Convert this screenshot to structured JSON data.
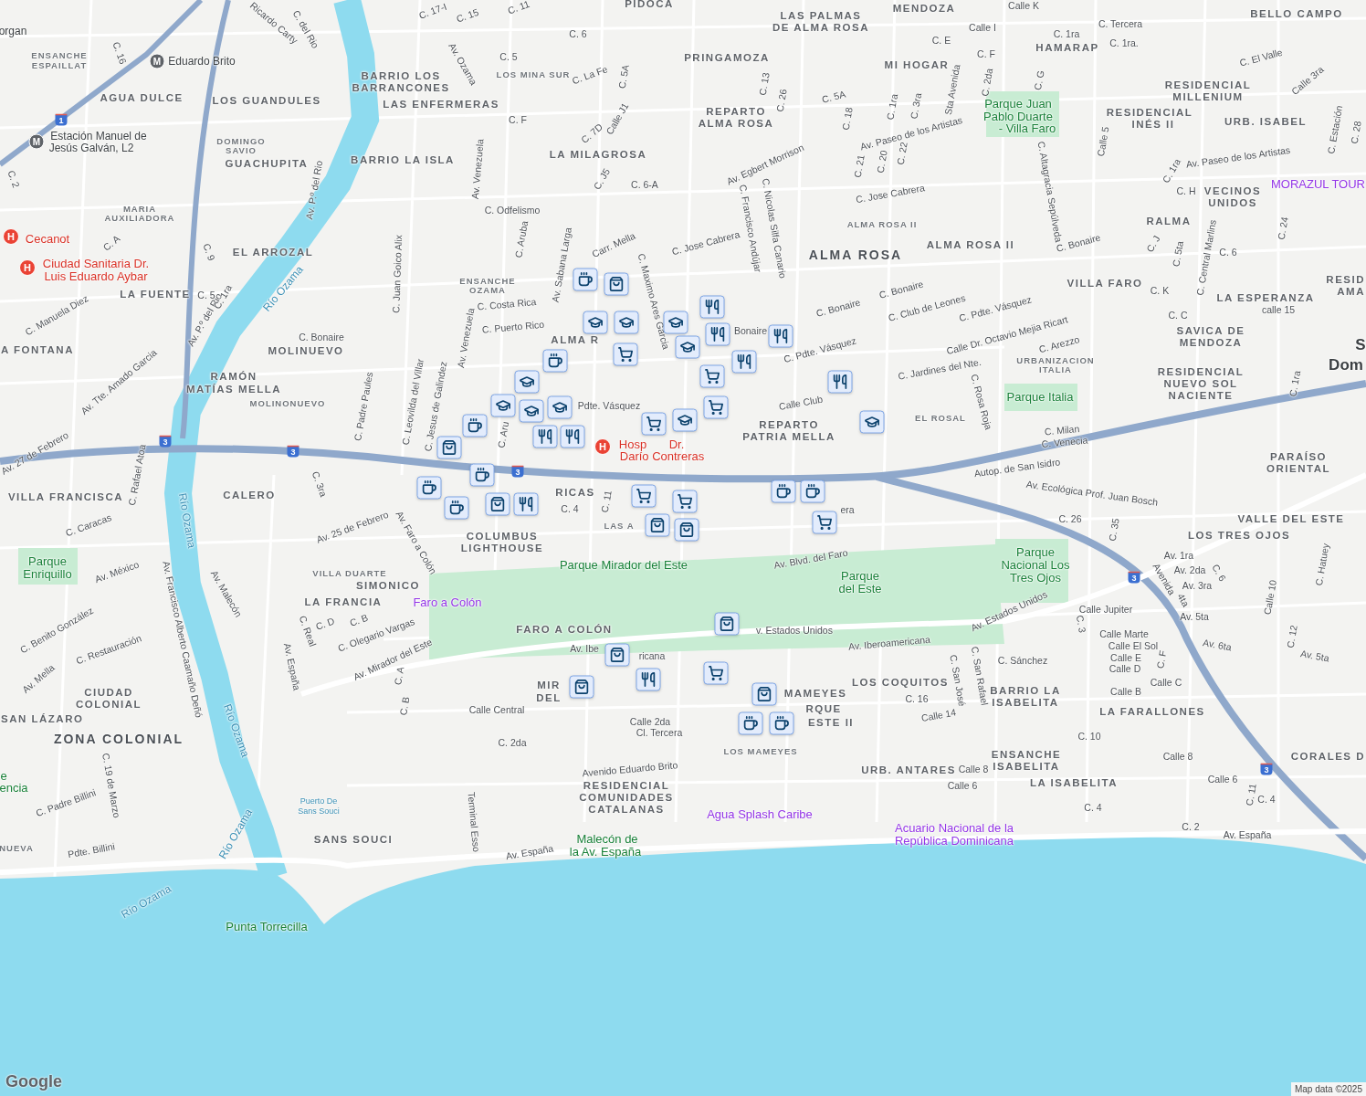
{
  "map": {
    "labels": [
      {
        "text": "ENSANCHE",
        "kind": "district-small"
      },
      {
        "text": "ESPAILLAT",
        "kind": "district-small"
      },
      {
        "text": "AGUA DULCE",
        "kind": "district"
      },
      {
        "text": "LOS GUANDULES",
        "kind": "district"
      },
      {
        "text": "BARRIO LOS",
        "kind": "district"
      },
      {
        "text": "BARRANCONES",
        "kind": "district"
      },
      {
        "text": "LAS ENFERMERAS",
        "kind": "district"
      },
      {
        "text": "PIDOCA",
        "kind": "district"
      },
      {
        "text": "LAS PALMAS",
        "kind": "district"
      },
      {
        "text": "DE ALMA ROSA",
        "kind": "district"
      },
      {
        "text": "MENDOZA",
        "kind": "district"
      },
      {
        "text": "BELLO CAMPO",
        "kind": "district"
      },
      {
        "text": "HAMARAP",
        "kind": "district"
      },
      {
        "text": "MI HOGAR",
        "kind": "district"
      },
      {
        "text": "PRINGAMOZA",
        "kind": "district"
      },
      {
        "text": "REPARTO",
        "kind": "district"
      },
      {
        "text": "ALMA ROSA",
        "kind": "district"
      },
      {
        "text": "RESIDENCIAL",
        "kind": "district"
      },
      {
        "text": "MILLENIUM",
        "kind": "district"
      },
      {
        "text": "RESIDENCIAL",
        "kind": "district"
      },
      {
        "text": "INÉS II",
        "kind": "district"
      },
      {
        "text": "URB. ISABEL",
        "kind": "district"
      },
      {
        "text": "DOMINGO",
        "kind": "district-small"
      },
      {
        "text": "SAVIO",
        "kind": "district-small"
      },
      {
        "text": "GUACHUPITA",
        "kind": "district"
      },
      {
        "text": "BARRIO LA ISLA",
        "kind": "district"
      },
      {
        "text": "LA MILAGROSA",
        "kind": "district"
      },
      {
        "text": "VECINOS",
        "kind": "district"
      },
      {
        "text": "UNIDOS",
        "kind": "district"
      },
      {
        "text": "MARIA",
        "kind": "district-small"
      },
      {
        "text": "AUXILIADORA",
        "kind": "district-small"
      },
      {
        "text": "RALMA",
        "kind": "district"
      },
      {
        "text": "EL ARROZAL",
        "kind": "district"
      },
      {
        "text": "ALMA ROSA",
        "kind": "district-large"
      },
      {
        "text": "ALMA ROSA II",
        "kind": "district"
      },
      {
        "text": "ENSANCHE",
        "kind": "district-small"
      },
      {
        "text": "OZAMA",
        "kind": "district-small"
      },
      {
        "text": "LA FUENTE",
        "kind": "district"
      },
      {
        "text": "VILLA FARO",
        "kind": "district"
      },
      {
        "text": "LA ESPERANZA",
        "kind": "district"
      },
      {
        "text": "A FONTANA",
        "kind": "district"
      },
      {
        "text": "MOLINUEVO",
        "kind": "district"
      },
      {
        "text": "SAVICA DE",
        "kind": "district"
      },
      {
        "text": "MENDOZA",
        "kind": "district"
      },
      {
        "text": "URBANIZACION",
        "kind": "district-small"
      },
      {
        "text": "ITALIA",
        "kind": "district-small"
      },
      {
        "text": "RAMÓN",
        "kind": "district"
      },
      {
        "text": "MATÍAS MELLA",
        "kind": "district"
      },
      {
        "text": "MOLINONUEVO",
        "kind": "district-small"
      },
      {
        "text": "RESIDENCIAL",
        "kind": "district"
      },
      {
        "text": "NUEVO SOL",
        "kind": "district"
      },
      {
        "text": "NACIENTE",
        "kind": "district"
      },
      {
        "text": "EL ROSAL",
        "kind": "district-small"
      },
      {
        "text": "REPARTO",
        "kind": "district"
      },
      {
        "text": "PATRIA MELLA",
        "kind": "district"
      },
      {
        "text": "PARAÍSO",
        "kind": "district"
      },
      {
        "text": "ORIENTAL",
        "kind": "district"
      },
      {
        "text": "VILLA FRANCISCA",
        "kind": "district"
      },
      {
        "text": "CALERO",
        "kind": "district"
      },
      {
        "text": "COLUMBUS",
        "kind": "district"
      },
      {
        "text": "LIGHTHOUSE",
        "kind": "district"
      },
      {
        "text": "VALLE DEL ESTE",
        "kind": "district"
      },
      {
        "text": "LOS TRES OJOS",
        "kind": "district"
      },
      {
        "text": "VILLA DUARTE",
        "kind": "district-small"
      },
      {
        "text": "SIMONICO",
        "kind": "district"
      },
      {
        "text": "LA FRANCIA",
        "kind": "district"
      },
      {
        "text": "FARO A COLÓN",
        "kind": "district"
      },
      {
        "text": "LOS COQUITOS",
        "kind": "district"
      },
      {
        "text": "BARRIO LA",
        "kind": "district"
      },
      {
        "text": "ISABELITA",
        "kind": "district"
      },
      {
        "text": "LA FARALLONES",
        "kind": "district"
      },
      {
        "text": "CIUDAD",
        "kind": "district"
      },
      {
        "text": "COLONIAL",
        "kind": "district"
      },
      {
        "text": "SAN LÁZARO",
        "kind": "district"
      },
      {
        "text": "ZONA COLONIAL",
        "kind": "district-large"
      },
      {
        "text": "ENSANCHE",
        "kind": "district"
      },
      {
        "text": "ISABELITA",
        "kind": "district"
      },
      {
        "text": "LA ISABELITA",
        "kind": "district"
      },
      {
        "text": "URB. ANTARES",
        "kind": "district"
      },
      {
        "text": "CORALES D",
        "kind": "district"
      },
      {
        "text": "RESIDENCIAL",
        "kind": "district"
      },
      {
        "text": "COMUNIDADES",
        "kind": "district"
      },
      {
        "text": "CATALANAS",
        "kind": "district"
      },
      {
        "text": "SANS SOUCI",
        "kind": "district"
      },
      {
        "text": "NUEVA",
        "kind": "district-small"
      },
      {
        "text": "LOS MAMEYES",
        "kind": "district-small"
      },
      {
        "text": "MAMEYES",
        "kind": "district"
      },
      {
        "text": "RQUE",
        "kind": "district"
      },
      {
        "text": "ESTE II",
        "kind": "district"
      },
      {
        "text": "MIR",
        "kind": "district"
      },
      {
        "text": "DEL",
        "kind": "district"
      },
      {
        "text": "RESID",
        "kind": "district"
      },
      {
        "text": "AMA",
        "kind": "district"
      },
      {
        "text": "ALMA R",
        "kind": "district"
      },
      {
        "text": "RICAS",
        "kind": "district"
      },
      {
        "text": "LAS A",
        "kind": "district-small"
      },
      {
        "text": "ALMA ROSA II",
        "kind": "district-small"
      },
      {
        "text": "LOS MINA SUR",
        "kind": "district-small"
      },
      {
        "text": "Parque Juan",
        "kind": "park"
      },
      {
        "text": "Pablo Duarte",
        "kind": "park"
      },
      {
        "text": "- Villa Faro",
        "kind": "park"
      },
      {
        "text": "Parque Italia",
        "kind": "park"
      },
      {
        "text": "Parque Mirador del Este",
        "kind": "park"
      },
      {
        "text": "Parque",
        "kind": "park"
      },
      {
        "text": "del Este",
        "kind": "park"
      },
      {
        "text": "Parque",
        "kind": "park"
      },
      {
        "text": "Nacional Los",
        "kind": "park"
      },
      {
        "text": "Tres Ojos",
        "kind": "park"
      },
      {
        "text": "Parque",
        "kind": "park"
      },
      {
        "text": "Enriquillo",
        "kind": "park"
      },
      {
        "text": "Punta Torrecilla",
        "kind": "park"
      },
      {
        "text": "Malecón de",
        "kind": "park"
      },
      {
        "text": "la Av. España",
        "kind": "park"
      },
      {
        "text": "e",
        "kind": "park"
      },
      {
        "text": "encia",
        "kind": "park"
      },
      {
        "text": "Cecanot",
        "kind": "hospital"
      },
      {
        "text": "Ciudad Sanitaria Dr.",
        "kind": "hospital"
      },
      {
        "text": "Luis Eduardo Aybar",
        "kind": "hospital"
      },
      {
        "text": "Hosp",
        "kind": "hospital"
      },
      {
        "text": "Dr.",
        "kind": "hospital"
      },
      {
        "text": "Darío Contreras",
        "kind": "hospital"
      },
      {
        "text": "Faro a Colón",
        "kind": "attraction"
      },
      {
        "text": "Agua Splash Caribe",
        "kind": "attraction"
      },
      {
        "text": "Acuario Nacional de la",
        "kind": "attraction"
      },
      {
        "text": "República Dominicana",
        "kind": "attraction"
      },
      {
        "text": "MORAZUL TOUR",
        "kind": "attraction"
      },
      {
        "text": "Eduardo Brito",
        "kind": "station"
      },
      {
        "text": "Estación Manuel de",
        "kind": "station"
      },
      {
        "text": "Jesús Galván, L2",
        "kind": "station"
      },
      {
        "text": "organ",
        "kind": "station"
      },
      {
        "text": "Río Ozama",
        "kind": "water"
      },
      {
        "text": "Río Ozama",
        "kind": "water"
      },
      {
        "text": "Río Ozama",
        "kind": "water"
      },
      {
        "text": "Río Ozama",
        "kind": "water"
      },
      {
        "text": "Río Ozama",
        "kind": "water"
      },
      {
        "text": "Puerto De",
        "kind": "water-small"
      },
      {
        "text": "Sans Souci",
        "kind": "water-small"
      },
      {
        "text": "S",
        "kind": "city"
      },
      {
        "text": "Dom",
        "kind": "city"
      },
      {
        "text": "Av. Venezuela",
        "kind": "street"
      },
      {
        "text": "Av. Venezuela",
        "kind": "street"
      },
      {
        "text": "C. Odfelismo",
        "kind": "street"
      },
      {
        "text": "Carr. Mella",
        "kind": "street"
      },
      {
        "text": "C. Jose Cabrera",
        "kind": "street"
      },
      {
        "text": "C. Jose Cabrera",
        "kind": "street"
      },
      {
        "text": "Av. Egbert Morrison",
        "kind": "street"
      },
      {
        "text": "Av. Paseo de los Artistas",
        "kind": "street"
      },
      {
        "text": "Av. Paseo de los Artistas",
        "kind": "street"
      },
      {
        "text": "C. Francisco Andújar",
        "kind": "street"
      },
      {
        "text": "C. Nicolas Silfa Canario",
        "kind": "street"
      },
      {
        "text": "C. Bonaire",
        "kind": "street"
      },
      {
        "text": "C. Bonaire",
        "kind": "street"
      },
      {
        "text": "C. Bonaire",
        "kind": "street"
      },
      {
        "text": "C. Bonaire",
        "kind": "street"
      },
      {
        "text": "C. Club de Leones",
        "kind": "street"
      },
      {
        "text": "C. Pdte. Vásquez",
        "kind": "street"
      },
      {
        "text": "C. Pdte. Vásquez",
        "kind": "street"
      },
      {
        "text": "Calle Dr. Octavio Mejia Ricart",
        "kind": "street"
      },
      {
        "text": "C. Arezzo",
        "kind": "street"
      },
      {
        "text": "C. Jardines del Nte.",
        "kind": "street"
      },
      {
        "text": "C. Rosa Roja",
        "kind": "street"
      },
      {
        "text": "C. Milan",
        "kind": "street"
      },
      {
        "text": "C. Venecia",
        "kind": "street"
      },
      {
        "text": "Autop. de San Isidro",
        "kind": "street"
      },
      {
        "text": "Av. Ecológica Prof. Juan Bosch",
        "kind": "street"
      },
      {
        "text": "C. 26",
        "kind": "street"
      },
      {
        "text": "C. 35",
        "kind": "street"
      },
      {
        "text": "Av. Blvd. del Faro",
        "kind": "street"
      },
      {
        "text": "v. Estados Unidos",
        "kind": "street"
      },
      {
        "text": "Av. Estados Unidos",
        "kind": "street"
      },
      {
        "text": "Av. Iberoamericana",
        "kind": "street"
      },
      {
        "text": "Av. Mirador del Este",
        "kind": "street"
      },
      {
        "text": "C. Olegario Vargas",
        "kind": "street"
      },
      {
        "text": "Av. España",
        "kind": "street"
      },
      {
        "text": "Av. España",
        "kind": "street"
      },
      {
        "text": "Av. España",
        "kind": "street"
      },
      {
        "text": "Calle Central",
        "kind": "street"
      },
      {
        "text": "C. 2da",
        "kind": "street"
      },
      {
        "text": "Calle 2da",
        "kind": "street"
      },
      {
        "text": "Cl. Tercera",
        "kind": "street"
      },
      {
        "text": "Avenido Eduardo Brito",
        "kind": "street"
      },
      {
        "text": "Terminal Esso",
        "kind": "street"
      },
      {
        "text": "C. Sánchez",
        "kind": "street"
      },
      {
        "text": "Calle Jupiter",
        "kind": "street"
      },
      {
        "text": "Calle Marte",
        "kind": "street"
      },
      {
        "text": "Calle El Sol",
        "kind": "street"
      },
      {
        "text": "Calle E",
        "kind": "street"
      },
      {
        "text": "Calle D",
        "kind": "street"
      },
      {
        "text": "Calle B",
        "kind": "street"
      },
      {
        "text": "Calle C",
        "kind": "street"
      },
      {
        "text": "Calle 14",
        "kind": "street"
      },
      {
        "text": "C. 16",
        "kind": "street"
      },
      {
        "text": "C. 10",
        "kind": "street"
      },
      {
        "text": "Calle 8",
        "kind": "street"
      },
      {
        "text": "Calle 8",
        "kind": "street"
      },
      {
        "text": "Calle 6",
        "kind": "street"
      },
      {
        "text": "Calle 6",
        "kind": "street"
      },
      {
        "text": "C. 4",
        "kind": "street"
      },
      {
        "text": "C. 4",
        "kind": "street"
      },
      {
        "text": "C. 2",
        "kind": "street"
      },
      {
        "text": "C. 11",
        "kind": "street"
      },
      {
        "text": "Av. 25 de Febrero",
        "kind": "street"
      },
      {
        "text": "Av. 27 de Febrero",
        "kind": "street"
      },
      {
        "text": "Av. Tte. Amado Garcia",
        "kind": "street"
      },
      {
        "text": "Av. Francisco Alberto Caamaño Deñó",
        "kind": "street"
      },
      {
        "text": "Av. P.º del Rio",
        "kind": "street"
      },
      {
        "text": "Av. Malecón",
        "kind": "street"
      },
      {
        "text": "C. Padre Billini",
        "kind": "street"
      },
      {
        "text": "Pdte. Billini",
        "kind": "street"
      },
      {
        "text": "C. 19 de Marzo",
        "kind": "street"
      },
      {
        "text": "C. Restauración",
        "kind": "street"
      },
      {
        "text": "C. Benito González",
        "kind": "street"
      },
      {
        "text": "Av. Mella",
        "kind": "street"
      },
      {
        "text": "Av. México",
        "kind": "street"
      },
      {
        "text": "C. Caracas",
        "kind": "street"
      },
      {
        "text": "C. Manuela Diez",
        "kind": "street"
      },
      {
        "text": "C. Rafael Atoa",
        "kind": "street"
      },
      {
        "text": "C. Juan Goico Alix",
        "kind": "street"
      },
      {
        "text": "C. Padre Paules",
        "kind": "street"
      },
      {
        "text": "C. Leovilda del Villar",
        "kind": "street"
      },
      {
        "text": "C. Jesus de Galindez",
        "kind": "street"
      },
      {
        "text": "C. Costa Rica",
        "kind": "street"
      },
      {
        "text": "C. Puerto Rico",
        "kind": "street"
      },
      {
        "text": "Av. Sabana Larga",
        "kind": "street"
      },
      {
        "text": "C. Maximo Ares Garcia",
        "kind": "street"
      },
      {
        "text": "C. Aruba",
        "kind": "street"
      },
      {
        "text": "Calle Club",
        "kind": "street"
      },
      {
        "text": "Calle K",
        "kind": "street"
      },
      {
        "text": "Calle I",
        "kind": "street"
      },
      {
        "text": "C. E",
        "kind": "street"
      },
      {
        "text": "C. F",
        "kind": "street"
      },
      {
        "text": "C. 1ra",
        "kind": "street"
      },
      {
        "text": "C. Tercera",
        "kind": "street"
      },
      {
        "text": "C. 1ra.",
        "kind": "street"
      },
      {
        "text": "C. El Valle",
        "kind": "street"
      },
      {
        "text": "Calle 3ra",
        "kind": "street"
      },
      {
        "text": "C. 5A",
        "kind": "street"
      },
      {
        "text": "C. 18",
        "kind": "street"
      },
      {
        "text": "C. 21",
        "kind": "street"
      },
      {
        "text": "C. 20",
        "kind": "street"
      },
      {
        "text": "C. 22",
        "kind": "street"
      },
      {
        "text": "C. 1ra",
        "kind": "street"
      },
      {
        "text": "C. 3ra",
        "kind": "street"
      },
      {
        "text": "Sta Avenida",
        "kind": "street"
      },
      {
        "text": "C. 2da",
        "kind": "street"
      },
      {
        "text": "C. G",
        "kind": "street"
      },
      {
        "text": "C. Altagracia Sepúlveda",
        "kind": "street"
      },
      {
        "text": "Calle 5",
        "kind": "street"
      },
      {
        "text": "C. 26",
        "kind": "street"
      },
      {
        "text": "C. 13",
        "kind": "street"
      },
      {
        "text": "Calle J1",
        "kind": "street"
      },
      {
        "text": "C. 7D",
        "kind": "street"
      },
      {
        "text": "C. 5A",
        "kind": "street"
      },
      {
        "text": "C. La Fe",
        "kind": "street"
      },
      {
        "text": "C. F",
        "kind": "street"
      },
      {
        "text": "C. 5",
        "kind": "street"
      },
      {
        "text": "Av. Ozama",
        "kind": "street"
      },
      {
        "text": "C. 6",
        "kind": "street"
      },
      {
        "text": "C. 15",
        "kind": "street"
      },
      {
        "text": "C. 17-I",
        "kind": "street"
      },
      {
        "text": "C. J5",
        "kind": "street"
      },
      {
        "text": "C. 6-A",
        "kind": "street"
      },
      {
        "text": "Ricardo Carty",
        "kind": "street"
      },
      {
        "text": "C. del Rio",
        "kind": "street"
      },
      {
        "text": "C. 16",
        "kind": "street"
      },
      {
        "text": "C. 2",
        "kind": "street"
      },
      {
        "text": "C. A",
        "kind": "street"
      },
      {
        "text": "C. 9",
        "kind": "street"
      },
      {
        "text": "C. 5",
        "kind": "street"
      },
      {
        "text": "C. 1ra",
        "kind": "street"
      },
      {
        "text": "Av. P.º del Rio",
        "kind": "street"
      },
      {
        "text": "C. 5ta",
        "kind": "street"
      },
      {
        "text": "C. Central Marlins",
        "kind": "street"
      },
      {
        "text": "C. 6",
        "kind": "street"
      },
      {
        "text": "C. J",
        "kind": "street"
      },
      {
        "text": "C. K",
        "kind": "street"
      },
      {
        "text": "C. C",
        "kind": "street"
      },
      {
        "text": "C. 24",
        "kind": "street"
      },
      {
        "text": "calle 15",
        "kind": "street"
      },
      {
        "text": "C. 1ra",
        "kind": "street"
      },
      {
        "text": "C. 1ra",
        "kind": "street"
      },
      {
        "text": "C. H",
        "kind": "street"
      },
      {
        "text": "C. 28",
        "kind": "street"
      },
      {
        "text": "C. Estación",
        "kind": "street"
      },
      {
        "text": "Av. 1ra",
        "kind": "street"
      },
      {
        "text": "Av. 2da",
        "kind": "street"
      },
      {
        "text": "Av. 3ra",
        "kind": "street"
      },
      {
        "text": "4ta",
        "kind": "street"
      },
      {
        "text": "Avenida",
        "kind": "street"
      },
      {
        "text": "Av. 5ta",
        "kind": "street"
      },
      {
        "text": "Av. 6ta",
        "kind": "street"
      },
      {
        "text": "Av. 5ta",
        "kind": "street"
      },
      {
        "text": "C. 6",
        "kind": "street"
      },
      {
        "text": "C. Hatuey",
        "kind": "street"
      },
      {
        "text": "Calle 10",
        "kind": "street"
      },
      {
        "text": "C. 12",
        "kind": "street"
      },
      {
        "text": "C. 3",
        "kind": "street"
      },
      {
        "text": "C. F",
        "kind": "street"
      },
      {
        "text": "C. San José",
        "kind": "street"
      },
      {
        "text": "C. San Rafael",
        "kind": "street"
      },
      {
        "text": "C. Real",
        "kind": "street"
      },
      {
        "text": "C. D",
        "kind": "street"
      },
      {
        "text": "C. B",
        "kind": "street"
      },
      {
        "text": "C. A",
        "kind": "street"
      },
      {
        "text": "C. B",
        "kind": "street"
      },
      {
        "text": "C. 4",
        "kind": "street"
      },
      {
        "text": "C. 11",
        "kind": "street"
      },
      {
        "text": "C. 3ra",
        "kind": "street"
      },
      {
        "text": "Av. Faro a Colón",
        "kind": "street"
      },
      {
        "text": "Pdte. Vásquez",
        "kind": "street"
      },
      {
        "text": "C. Aru",
        "kind": "street"
      },
      {
        "text": "Bonaire",
        "kind": "street"
      },
      {
        "text": "Av. Ibe",
        "kind": "street"
      },
      {
        "text": "ricana",
        "kind": "street"
      },
      {
        "text": "era",
        "kind": "street"
      },
      {
        "text": "C. 11",
        "kind": "street"
      },
      {
        "text": "1",
        "kind": "shield"
      },
      {
        "text": "3",
        "kind": "shield"
      },
      {
        "text": "3",
        "kind": "shield"
      },
      {
        "text": "3",
        "kind": "shield"
      },
      {
        "text": "3",
        "kind": "shield"
      },
      {
        "text": "3",
        "kind": "shield"
      },
      {
        "text": "H",
        "kind": "hospital-pin"
      },
      {
        "text": "H",
        "kind": "hospital-pin"
      },
      {
        "text": "H",
        "kind": "hospital-pin"
      },
      {
        "text": "M",
        "kind": "metro-pin"
      },
      {
        "text": "M",
        "kind": "metro-pin"
      }
    ],
    "markers": [
      {
        "kind": "cafe"
      },
      {
        "kind": "shop"
      },
      {
        "kind": "school"
      },
      {
        "kind": "school"
      },
      {
        "kind": "grocery"
      },
      {
        "kind": "school"
      },
      {
        "kind": "restaurant"
      },
      {
        "kind": "restaurant"
      },
      {
        "kind": "school"
      },
      {
        "kind": "restaurant"
      },
      {
        "kind": "grocery"
      },
      {
        "kind": "restaurant"
      },
      {
        "kind": "restaurant"
      },
      {
        "kind": "cafe"
      },
      {
        "kind": "school"
      },
      {
        "kind": "school"
      },
      {
        "kind": "school"
      },
      {
        "kind": "school"
      },
      {
        "kind": "cafe"
      },
      {
        "kind": "shop"
      },
      {
        "kind": "restaurant"
      },
      {
        "kind": "restaurant"
      },
      {
        "kind": "grocery"
      },
      {
        "kind": "grocery"
      },
      {
        "kind": "school"
      },
      {
        "kind": "school"
      },
      {
        "kind": "cafe"
      },
      {
        "kind": "cafe"
      },
      {
        "kind": "cafe"
      },
      {
        "kind": "shop"
      },
      {
        "kind": "restaurant"
      },
      {
        "kind": "grocery"
      },
      {
        "kind": "grocery"
      },
      {
        "kind": "shop"
      },
      {
        "kind": "shop"
      },
      {
        "kind": "cafe"
      },
      {
        "kind": "cafe"
      },
      {
        "kind": "grocery"
      },
      {
        "kind": "shop"
      },
      {
        "kind": "shop"
      },
      {
        "kind": "restaurant"
      },
      {
        "kind": "shop"
      },
      {
        "kind": "grocery"
      },
      {
        "kind": "shop"
      },
      {
        "kind": "cafe"
      },
      {
        "kind": "cafe"
      }
    ]
  },
  "attribution": {
    "logo": "Google",
    "text": "Map data ©2025"
  }
}
